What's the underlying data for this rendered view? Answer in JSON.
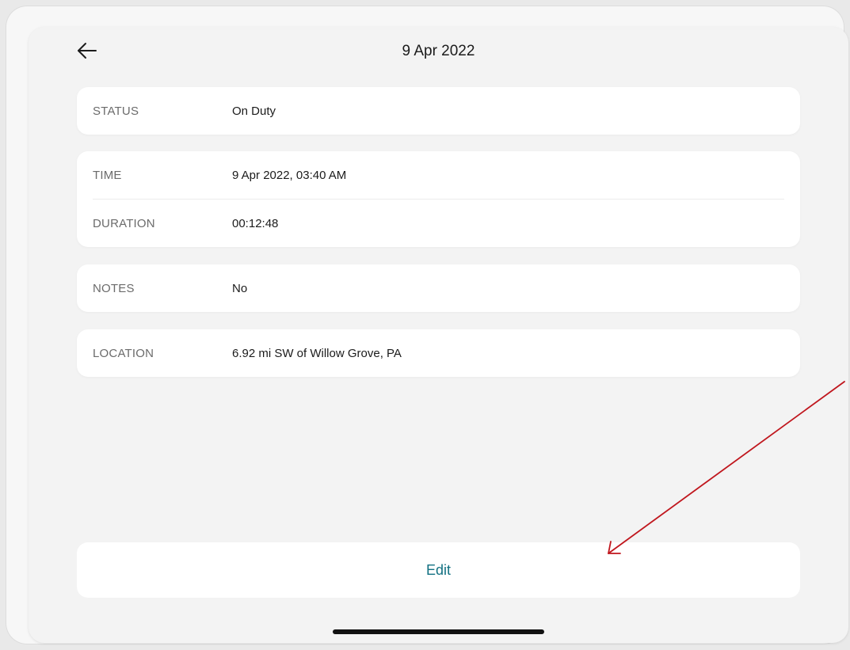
{
  "header": {
    "title": "9 Apr 2022",
    "back_icon": "arrow-left-icon"
  },
  "status_card": {
    "label": "STATUS",
    "value": "On Duty"
  },
  "time_card": {
    "time_label": "TIME",
    "time_value": "9 Apr 2022, 03:40 AM",
    "duration_label": "DURATION",
    "duration_value": "00:12:48"
  },
  "notes_card": {
    "label": "NOTES",
    "value": "No"
  },
  "location_card": {
    "label": "LOCATION",
    "value": "6.92 mi SW of Willow Grove, PA"
  },
  "actions": {
    "edit_label": "Edit"
  },
  "colors": {
    "accent": "#137182",
    "annotation_arrow": "#c0161d"
  }
}
